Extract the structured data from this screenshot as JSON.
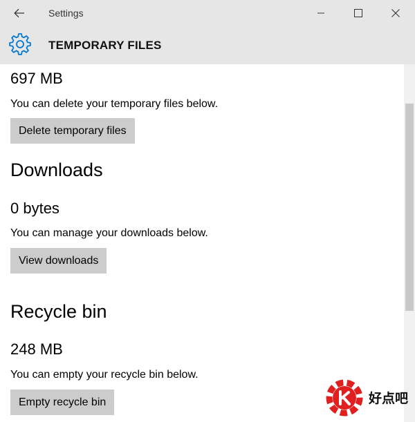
{
  "window": {
    "title": "Settings",
    "back_icon": "arrow-left-icon",
    "controls": [
      "minimize-icon",
      "maximize-icon",
      "close-icon"
    ]
  },
  "header": {
    "icon": "gear-icon",
    "title": "TEMPORARY FILES",
    "accent_color": "#0078d7"
  },
  "sections": {
    "temp": {
      "size": "697 MB",
      "description": "You can delete your temporary files below.",
      "button_label": "Delete temporary files"
    },
    "downloads": {
      "title": "Downloads",
      "size": "0 bytes",
      "description": "You can manage your downloads below.",
      "button_label": "View downloads"
    },
    "recycle": {
      "title": "Recycle bin",
      "size": "248 MB",
      "description": "You can empty your recycle bin below.",
      "button_label": "Empty recycle bin"
    }
  },
  "watermark": {
    "text": "好点吧",
    "logo_color": "#e02020"
  }
}
